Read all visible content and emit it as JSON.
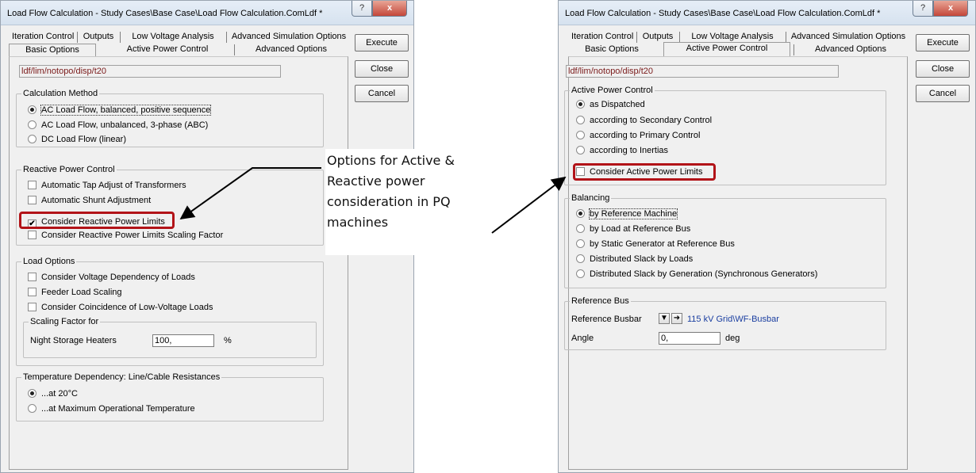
{
  "left_dialog": {
    "title": "Load Flow Calculation - Study Cases\\Base Case\\Load Flow Calculation.ComLdf *",
    "help_symbol": "?",
    "close_symbol": "x",
    "tabs_back": [
      "Iteration Control",
      "Outputs",
      "Low Voltage Analysis",
      "Advanced Simulation Options"
    ],
    "tabs_front": [
      "Basic Options",
      "Active Power Control",
      "Advanced Options"
    ],
    "active_tab": "Basic Options",
    "path": "ldf/lim/notopo/disp/t20",
    "buttons": {
      "execute": "Execute",
      "close": "Close",
      "cancel": "Cancel"
    },
    "calc_method": {
      "title": "Calculation Method",
      "options": [
        "AC Load Flow, balanced, positive sequence",
        "AC Load Flow, unbalanced, 3-phase (ABC)",
        "DC Load Flow (linear)"
      ],
      "selected": 0
    },
    "reactive": {
      "title": "Reactive Power Control",
      "options": [
        "Automatic Tap Adjust of Transformers",
        "Automatic Shunt Adjustment",
        "Consider Reactive Power Limits",
        "Consider Reactive Power Limits Scaling Factor"
      ],
      "checked": [
        false,
        false,
        true,
        false
      ]
    },
    "load_options": {
      "title": "Load Options",
      "options": [
        "Consider Voltage Dependency of Loads",
        "Feeder Load Scaling",
        "Consider Coincidence of Low-Voltage Loads"
      ],
      "scaling": {
        "title": "Scaling Factor for",
        "label": "Night Storage Heaters",
        "value": "100,",
        "unit": "%"
      }
    },
    "temperature": {
      "title": "Temperature Dependency: Line/Cable Resistances",
      "options": [
        "...at 20°C",
        "...at Maximum Operational Temperature"
      ],
      "selected": 0
    }
  },
  "right_dialog": {
    "title": "Load Flow Calculation - Study Cases\\Base Case\\Load Flow Calculation.ComLdf *",
    "help_symbol": "?",
    "close_symbol": "x",
    "tabs_back": [
      "Iteration Control",
      "Outputs",
      "Low Voltage Analysis",
      "Advanced Simulation Options"
    ],
    "tabs_front": [
      "Basic Options",
      "Active Power Control",
      "Advanced Options"
    ],
    "active_tab": "Active Power Control",
    "path": "ldf/lim/notopo/disp/t20",
    "buttons": {
      "execute": "Execute",
      "close": "Close",
      "cancel": "Cancel"
    },
    "active_power": {
      "title": "Active Power Control",
      "options": [
        "as Dispatched",
        "according to Secondary Control",
        "according to Primary Control",
        "according to Inertias"
      ],
      "selected": 0,
      "limits_label": "Consider Active Power Limits",
      "limits_checked": false
    },
    "balancing": {
      "title": "Balancing",
      "options": [
        "by Reference Machine",
        "by Load at Reference Bus",
        "by Static Generator at Reference Bus",
        "Distributed Slack by Loads",
        "Distributed Slack by Generation (Synchronous Generators)"
      ],
      "selected": 0
    },
    "reference_bus": {
      "title": "Reference Bus",
      "busbar_label": "Reference Busbar",
      "busbar_value": "115 kV Grid\\WF-Busbar",
      "angle_label": "Angle",
      "angle_value": "0,",
      "angle_unit": "deg"
    }
  },
  "annotation": {
    "text": "Options for Active & Reactive power consideration in PQ machines"
  },
  "colors": {
    "highlight": "#b21318",
    "path_text": "#7a1a1a",
    "link_text": "#1a3ea0"
  }
}
